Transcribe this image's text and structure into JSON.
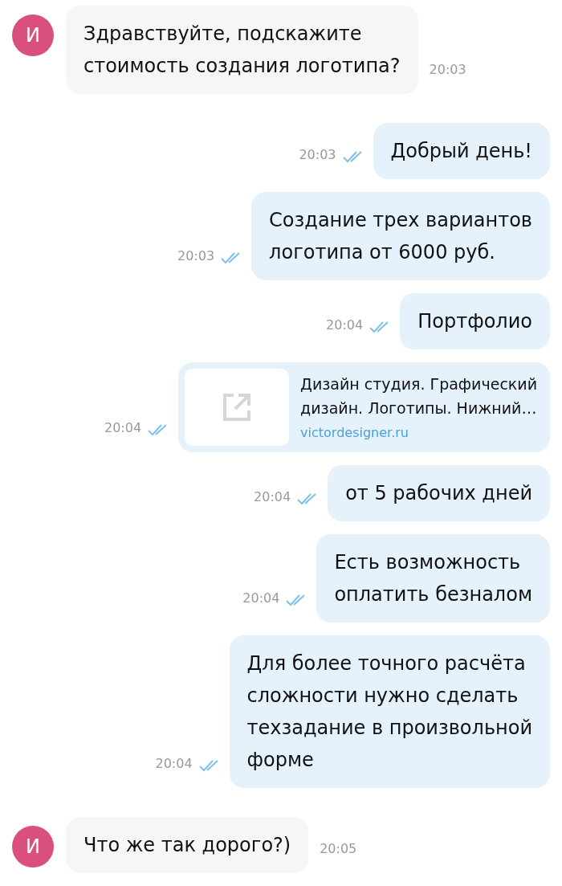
{
  "messages": [
    {
      "outgoing": false,
      "kind": "text",
      "avatar": "И",
      "text": "Здравствуйте, подскажите\nстоимость создания логотипа?",
      "time": "20:03"
    },
    {
      "outgoing": true,
      "kind": "text",
      "text": "Добрый день!",
      "time": "20:03",
      "read": true
    },
    {
      "outgoing": true,
      "kind": "text",
      "text": "Создание трех вариантов\nлоготипа от 6000 руб.",
      "time": "20:03",
      "read": true
    },
    {
      "outgoing": true,
      "kind": "text",
      "text": "Портфолио",
      "time": "20:04",
      "read": true
    },
    {
      "outgoing": true,
      "kind": "link",
      "title": "Дизайн студия. Графический\nдизайн. Логотипы. Нижний…",
      "url": "victordesigner.ru",
      "time": "20:04",
      "read": true
    },
    {
      "outgoing": true,
      "kind": "text",
      "text": "от 5 рабочих дней",
      "time": "20:04",
      "read": true
    },
    {
      "outgoing": true,
      "kind": "text",
      "text": "Есть возможность\nоплатить безналом",
      "time": "20:04",
      "read": true
    },
    {
      "outgoing": true,
      "kind": "text",
      "text": "Для более точного расчёта\nсложности нужно сделать\nтехзадание в произвольной\nформе",
      "time": "20:04",
      "read": true
    },
    {
      "outgoing": false,
      "kind": "text",
      "avatar": "И",
      "text": "Что же так дорого?)",
      "time": "20:05"
    }
  ]
}
